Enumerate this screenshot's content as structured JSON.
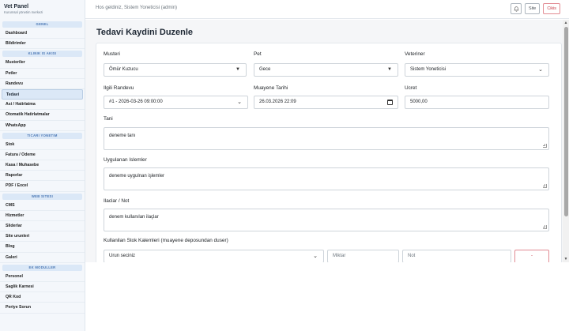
{
  "brand": {
    "title": "Vet Panel",
    "subtitle": "Kurumsal yönetim merkezi"
  },
  "sidebar": {
    "sections": [
      {
        "title": "GENEL",
        "items": [
          "Dashboard",
          "Bildirimler"
        ]
      },
      {
        "title": "KLINIK IS AKISI",
        "items": [
          "Musteriler",
          "Petler",
          "Randevu",
          "Tedavi",
          "Asi / Hatirlatma",
          "Otomatik Hatirlatmalar",
          "WhatsApp"
        ]
      },
      {
        "title": "TICARI YONETIM",
        "items": [
          "Stok",
          "Fatura / Odeme",
          "Kasa / Muhasebe",
          "Raporlar",
          "PDF / Excel"
        ]
      },
      {
        "title": "WEB SITESI",
        "items": [
          "CMS",
          "Hizmetler",
          "Sliderlar",
          "Site urunleri",
          "Blog",
          "Galeri"
        ]
      },
      {
        "title": "EK MODULLER",
        "items": [
          "Personel",
          "Saglik Karnesi",
          "QR Kod",
          "Periye Sorun"
        ]
      }
    ],
    "active_item": "Tedavi"
  },
  "topbar": {
    "welcome": "Hos geldiniz, Sistem Yoneticisi (admin)",
    "site_label": "Site",
    "logout_label": "Cikis"
  },
  "page": {
    "title": "Tedavi Kaydini Duzenle"
  },
  "form": {
    "musteri": {
      "label": "Musteri",
      "value": "Ömür Kuzucu"
    },
    "pet": {
      "label": "Pet",
      "value": "Gece"
    },
    "veteriner": {
      "label": "Veteriner",
      "value": "Sistem Yoneticisi"
    },
    "randevu": {
      "label": "Ilgili Randevu",
      "value": "#1 - 2026-03-26 09:00:00"
    },
    "muayene": {
      "label": "Muayene Tarihi",
      "value": "26.03.2026 22:09"
    },
    "ucret": {
      "label": "Ucret",
      "value": "5000,00"
    },
    "tani": {
      "label": "Tani",
      "value": "deneme tanı"
    },
    "islemler": {
      "label": "Uygulanan Islemler",
      "value": "deneme uygulnan işlemler"
    },
    "ilaclar": {
      "label": "Ilaclar / Not",
      "value": "denem kullanılan ilaçlar"
    },
    "stok": {
      "label": "Kullanilan Stok Kalemleri (muayene deposundan duser)",
      "product_placeholder": "Urun seciniz",
      "qty_placeholder": "Miktar",
      "note_placeholder": "Not",
      "remove_label": "-"
    }
  }
}
